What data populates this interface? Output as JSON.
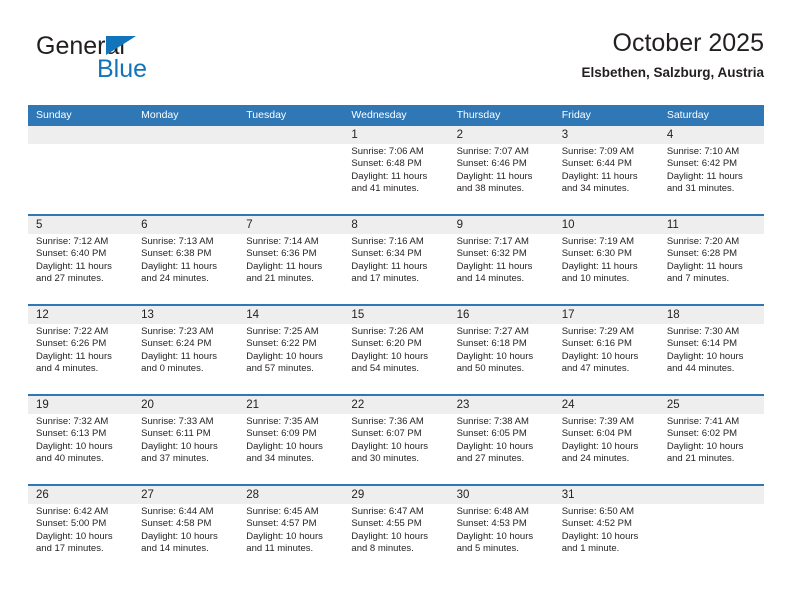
{
  "brand": {
    "name_top": "General",
    "name_bottom": "Blue",
    "color_blue": "#1274bb",
    "color_dark": "#231f20"
  },
  "header": {
    "title": "October 2025",
    "subtitle": "Elsbethen, Salzburg, Austria"
  },
  "theme": {
    "header_blue": "#3077b6",
    "daynum_band": "#eeeeee",
    "text": "#231f20"
  },
  "weekdays": [
    "Sunday",
    "Monday",
    "Tuesday",
    "Wednesday",
    "Thursday",
    "Friday",
    "Saturday"
  ],
  "weeks": [
    [
      {
        "day": "",
        "lines": []
      },
      {
        "day": "",
        "lines": []
      },
      {
        "day": "",
        "lines": []
      },
      {
        "day": "1",
        "lines": [
          "Sunrise: 7:06 AM",
          "Sunset: 6:48 PM",
          "Daylight: 11 hours",
          "and 41 minutes."
        ]
      },
      {
        "day": "2",
        "lines": [
          "Sunrise: 7:07 AM",
          "Sunset: 6:46 PM",
          "Daylight: 11 hours",
          "and 38 minutes."
        ]
      },
      {
        "day": "3",
        "lines": [
          "Sunrise: 7:09 AM",
          "Sunset: 6:44 PM",
          "Daylight: 11 hours",
          "and 34 minutes."
        ]
      },
      {
        "day": "4",
        "lines": [
          "Sunrise: 7:10 AM",
          "Sunset: 6:42 PM",
          "Daylight: 11 hours",
          "and 31 minutes."
        ]
      }
    ],
    [
      {
        "day": "5",
        "lines": [
          "Sunrise: 7:12 AM",
          "Sunset: 6:40 PM",
          "Daylight: 11 hours",
          "and 27 minutes."
        ]
      },
      {
        "day": "6",
        "lines": [
          "Sunrise: 7:13 AM",
          "Sunset: 6:38 PM",
          "Daylight: 11 hours",
          "and 24 minutes."
        ]
      },
      {
        "day": "7",
        "lines": [
          "Sunrise: 7:14 AM",
          "Sunset: 6:36 PM",
          "Daylight: 11 hours",
          "and 21 minutes."
        ]
      },
      {
        "day": "8",
        "lines": [
          "Sunrise: 7:16 AM",
          "Sunset: 6:34 PM",
          "Daylight: 11 hours",
          "and 17 minutes."
        ]
      },
      {
        "day": "9",
        "lines": [
          "Sunrise: 7:17 AM",
          "Sunset: 6:32 PM",
          "Daylight: 11 hours",
          "and 14 minutes."
        ]
      },
      {
        "day": "10",
        "lines": [
          "Sunrise: 7:19 AM",
          "Sunset: 6:30 PM",
          "Daylight: 11 hours",
          "and 10 minutes."
        ]
      },
      {
        "day": "11",
        "lines": [
          "Sunrise: 7:20 AM",
          "Sunset: 6:28 PM",
          "Daylight: 11 hours",
          "and 7 minutes."
        ]
      }
    ],
    [
      {
        "day": "12",
        "lines": [
          "Sunrise: 7:22 AM",
          "Sunset: 6:26 PM",
          "Daylight: 11 hours",
          "and 4 minutes."
        ]
      },
      {
        "day": "13",
        "lines": [
          "Sunrise: 7:23 AM",
          "Sunset: 6:24 PM",
          "Daylight: 11 hours",
          "and 0 minutes."
        ]
      },
      {
        "day": "14",
        "lines": [
          "Sunrise: 7:25 AM",
          "Sunset: 6:22 PM",
          "Daylight: 10 hours",
          "and 57 minutes."
        ]
      },
      {
        "day": "15",
        "lines": [
          "Sunrise: 7:26 AM",
          "Sunset: 6:20 PM",
          "Daylight: 10 hours",
          "and 54 minutes."
        ]
      },
      {
        "day": "16",
        "lines": [
          "Sunrise: 7:27 AM",
          "Sunset: 6:18 PM",
          "Daylight: 10 hours",
          "and 50 minutes."
        ]
      },
      {
        "day": "17",
        "lines": [
          "Sunrise: 7:29 AM",
          "Sunset: 6:16 PM",
          "Daylight: 10 hours",
          "and 47 minutes."
        ]
      },
      {
        "day": "18",
        "lines": [
          "Sunrise: 7:30 AM",
          "Sunset: 6:14 PM",
          "Daylight: 10 hours",
          "and 44 minutes."
        ]
      }
    ],
    [
      {
        "day": "19",
        "lines": [
          "Sunrise: 7:32 AM",
          "Sunset: 6:13 PM",
          "Daylight: 10 hours",
          "and 40 minutes."
        ]
      },
      {
        "day": "20",
        "lines": [
          "Sunrise: 7:33 AM",
          "Sunset: 6:11 PM",
          "Daylight: 10 hours",
          "and 37 minutes."
        ]
      },
      {
        "day": "21",
        "lines": [
          "Sunrise: 7:35 AM",
          "Sunset: 6:09 PM",
          "Daylight: 10 hours",
          "and 34 minutes."
        ]
      },
      {
        "day": "22",
        "lines": [
          "Sunrise: 7:36 AM",
          "Sunset: 6:07 PM",
          "Daylight: 10 hours",
          "and 30 minutes."
        ]
      },
      {
        "day": "23",
        "lines": [
          "Sunrise: 7:38 AM",
          "Sunset: 6:05 PM",
          "Daylight: 10 hours",
          "and 27 minutes."
        ]
      },
      {
        "day": "24",
        "lines": [
          "Sunrise: 7:39 AM",
          "Sunset: 6:04 PM",
          "Daylight: 10 hours",
          "and 24 minutes."
        ]
      },
      {
        "day": "25",
        "lines": [
          "Sunrise: 7:41 AM",
          "Sunset: 6:02 PM",
          "Daylight: 10 hours",
          "and 21 minutes."
        ]
      }
    ],
    [
      {
        "day": "26",
        "lines": [
          "Sunrise: 6:42 AM",
          "Sunset: 5:00 PM",
          "Daylight: 10 hours",
          "and 17 minutes."
        ]
      },
      {
        "day": "27",
        "lines": [
          "Sunrise: 6:44 AM",
          "Sunset: 4:58 PM",
          "Daylight: 10 hours",
          "and 14 minutes."
        ]
      },
      {
        "day": "28",
        "lines": [
          "Sunrise: 6:45 AM",
          "Sunset: 4:57 PM",
          "Daylight: 10 hours",
          "and 11 minutes."
        ]
      },
      {
        "day": "29",
        "lines": [
          "Sunrise: 6:47 AM",
          "Sunset: 4:55 PM",
          "Daylight: 10 hours",
          "and 8 minutes."
        ]
      },
      {
        "day": "30",
        "lines": [
          "Sunrise: 6:48 AM",
          "Sunset: 4:53 PM",
          "Daylight: 10 hours",
          "and 5 minutes."
        ]
      },
      {
        "day": "31",
        "lines": [
          "Sunrise: 6:50 AM",
          "Sunset: 4:52 PM",
          "Daylight: 10 hours",
          "and 1 minute."
        ]
      },
      {
        "day": "",
        "lines": []
      }
    ]
  ]
}
